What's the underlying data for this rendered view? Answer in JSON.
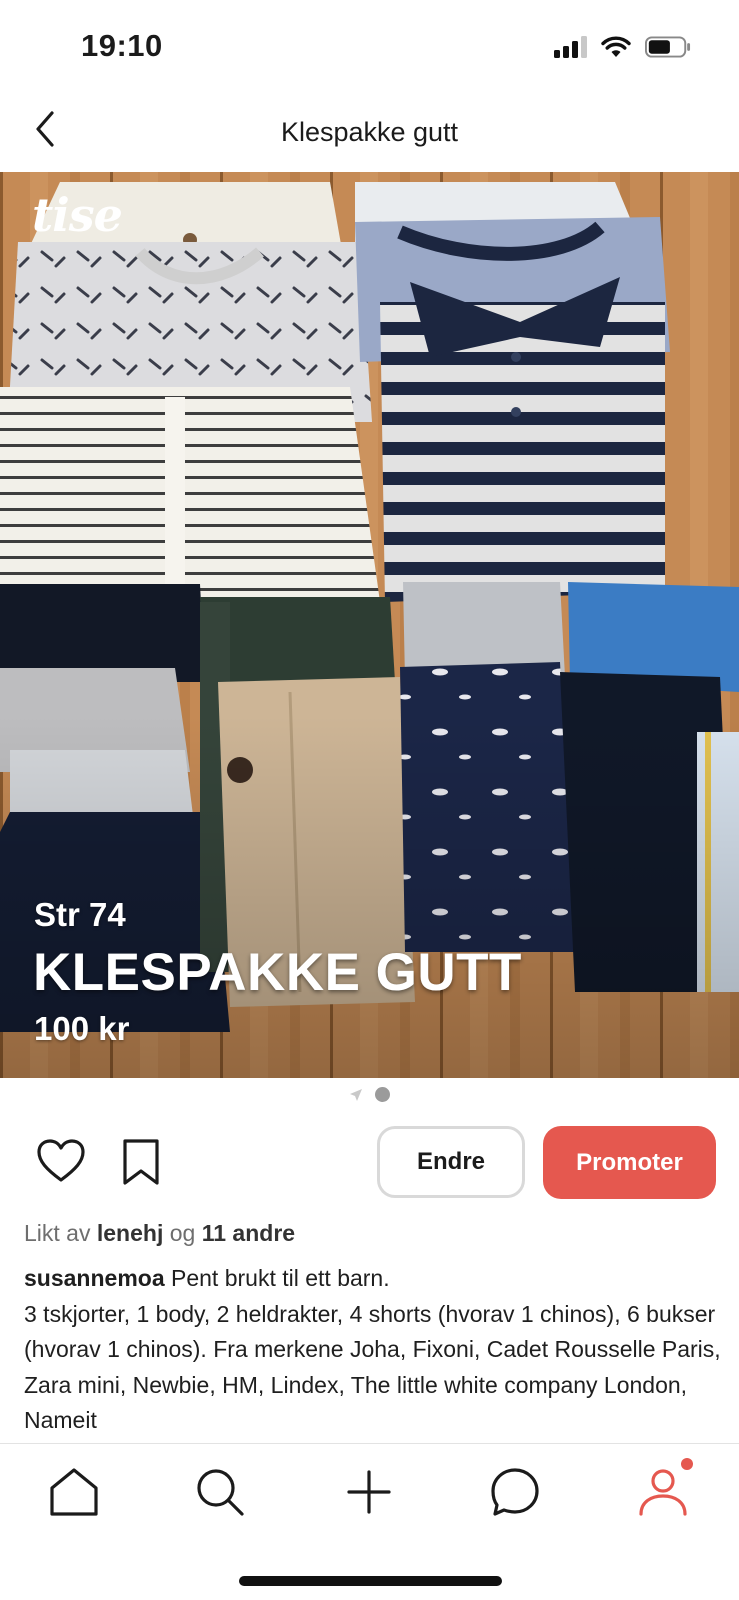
{
  "status_bar": {
    "time": "19:10"
  },
  "header": {
    "title": "Klespakke gutt"
  },
  "photo": {
    "watermark": "tise",
    "overlay": {
      "size": "Str 74",
      "title": "KLESPAKKE GUTT",
      "price": "100 kr"
    }
  },
  "pager": {
    "count": 2,
    "active_index": 1
  },
  "actions": {
    "edit_label": "Endre",
    "promote_label": "Promoter"
  },
  "likes": {
    "prefix": "Likt av",
    "user": "lenehj",
    "joiner": "og",
    "others": "11 andre"
  },
  "description": {
    "author": "susannemoa",
    "text": " Pent brukt til ett barn.\n3 tskjorter, 1 body, 2 heldrakter, 4 shorts (hvorav 1 chinos), 6 bukser (hvorav 1 chinos). Fra merkene Joha, Fixoni, Cadet Rousselle Paris, Zara mini, Newbie, HM, Lindex, The little white company London, Nameit"
  },
  "bottom_nav": {
    "items": [
      {
        "icon": "home-icon"
      },
      {
        "icon": "search-icon"
      },
      {
        "icon": "add-icon"
      },
      {
        "icon": "chat-icon"
      },
      {
        "icon": "profile-icon",
        "active": true,
        "badge": true
      }
    ]
  },
  "colors": {
    "accent": "#e5584f",
    "text": "#1b1b1b",
    "muted": "#6e6e6e",
    "border": "#d9d9d9"
  }
}
